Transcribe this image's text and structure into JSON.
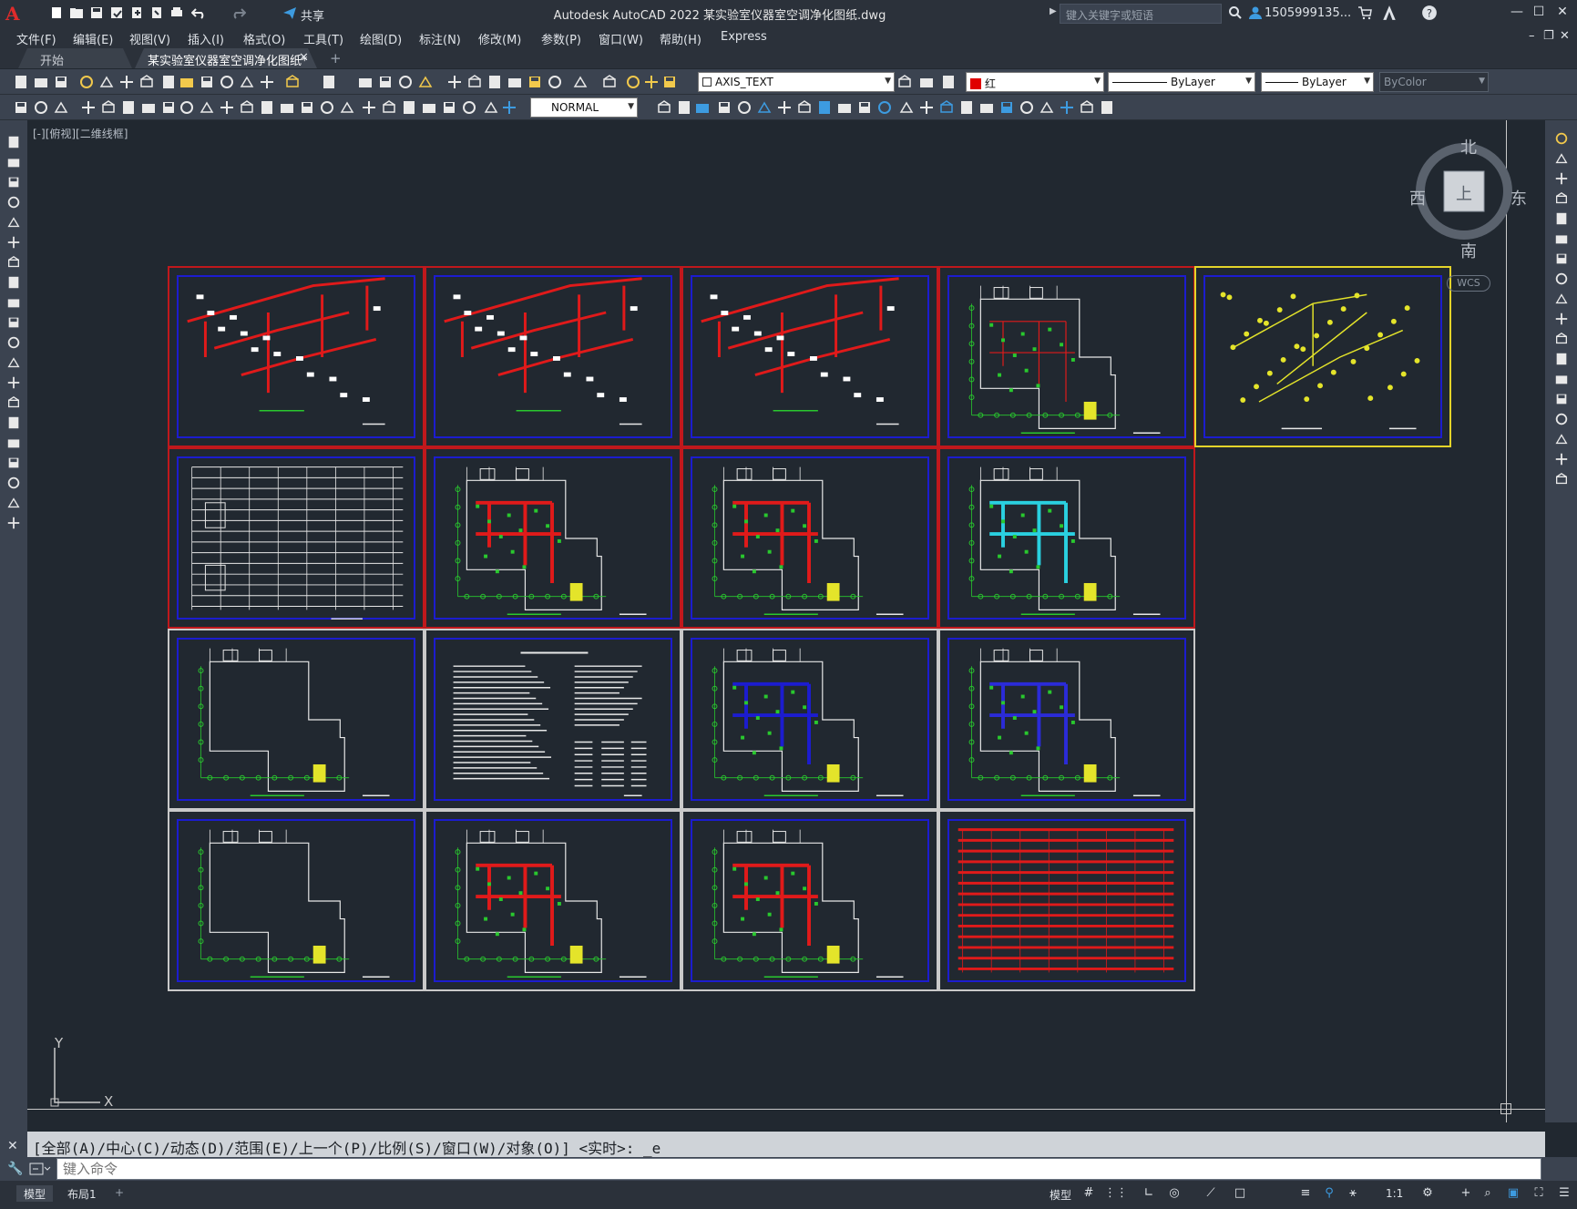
{
  "app": {
    "title": "Autodesk AutoCAD 2022    某实验室仪器室空调净化图纸.dwg",
    "share_label": "共享",
    "search_placeholder": "键入关键字或短语",
    "user": "1505999135..."
  },
  "menu": [
    "文件(F)",
    "编辑(E)",
    "视图(V)",
    "插入(I)",
    "格式(O)",
    "工具(T)",
    "绘图(D)",
    "标注(N)",
    "修改(M)",
    "参数(P)",
    "窗口(W)",
    "帮助(H)",
    "Express"
  ],
  "tabs": {
    "start": "开始",
    "active": "某实验室仪器室空调净化图纸*"
  },
  "toolbar": {
    "layer": "AXIS_TEXT",
    "color": "红",
    "linetype": "ByLayer",
    "lineweight": "ByLayer",
    "plotstyle": "ByColor",
    "dimstyle": "NORMAL",
    "layer_color": "#e00000"
  },
  "viewport": {
    "label": "[-][俯视][二维线框]"
  },
  "viewcube": {
    "north": "北",
    "south": "南",
    "east": "东",
    "west": "西",
    "top": "上",
    "wcs": "WCS"
  },
  "ucs": {
    "x": "X",
    "y": "Y"
  },
  "command": {
    "history": "[全部(A)/中心(C)/动态(D)/范围(E)/上一个(P)/比例(S)/窗口(W)/对象(O)] <实时>: _e",
    "placeholder": "键入命令"
  },
  "status": {
    "model_tab": "模型",
    "layout_tab": "布局1",
    "model_button": "模型",
    "scale": "1:1"
  },
  "colors": {
    "red_border": "#c0181c",
    "yellow_border": "#e4d42a",
    "blue_frame": "#1c1ccf"
  }
}
